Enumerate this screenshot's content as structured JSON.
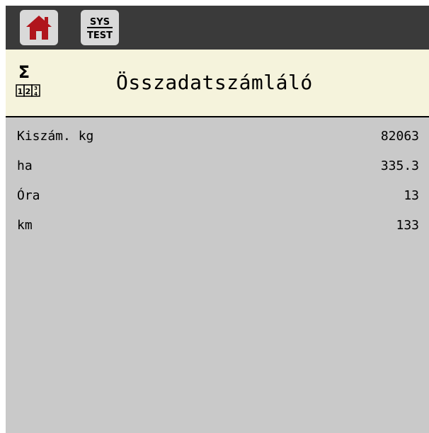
{
  "toolbar": {
    "home_icon": "home-icon",
    "sys_test": {
      "top": "SYS",
      "bottom": "TEST"
    }
  },
  "header": {
    "icon": "totals-counter-icon",
    "icon_digits": [
      "1",
      "2",
      "3",
      "4"
    ],
    "title": "Összadatszámláló"
  },
  "rows": [
    {
      "label": "Kiszám. kg",
      "value": "82063"
    },
    {
      "label": "ha",
      "value": "335.3"
    },
    {
      "label": "Óra",
      "value": "13"
    },
    {
      "label": "km",
      "value": "133"
    }
  ],
  "colors": {
    "accent_red": "#b0151c",
    "header_bg": "#f5f3dc",
    "content_bg": "#c9c9c9",
    "topbar_bg": "#3a3a3a"
  }
}
